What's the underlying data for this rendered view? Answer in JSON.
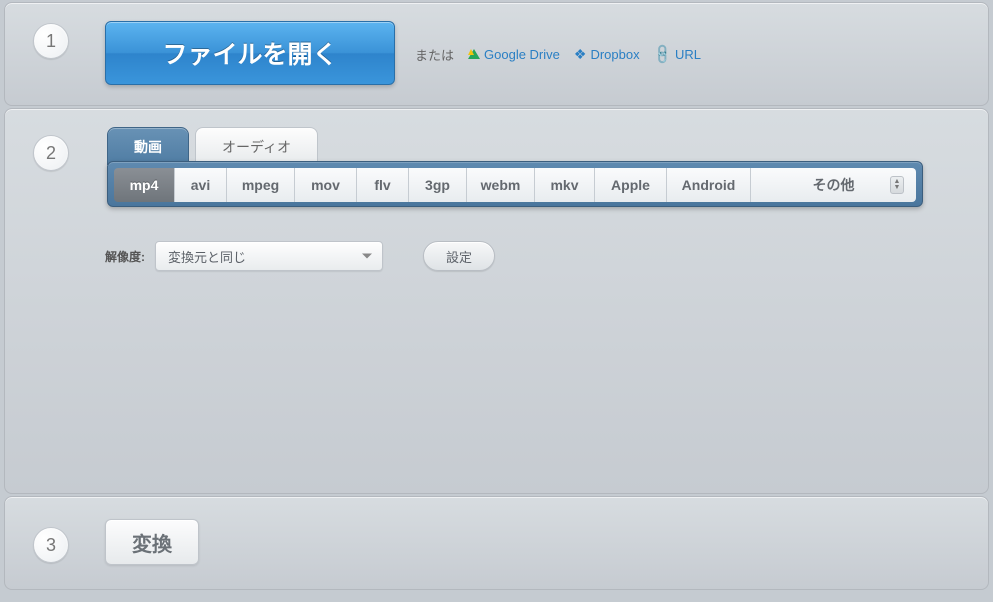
{
  "steps": {
    "one": "1",
    "two": "2",
    "three": "3"
  },
  "open": {
    "button": "ファイルを開く",
    "or": "または",
    "google_drive": "Google Drive",
    "dropbox": "Dropbox",
    "url": "URL"
  },
  "tabs": {
    "video": "動画",
    "audio": "オーディオ"
  },
  "formats": {
    "mp4": "mp4",
    "avi": "avi",
    "mpeg": "mpeg",
    "mov": "mov",
    "flv": "flv",
    "threegp": "3gp",
    "webm": "webm",
    "mkv": "mkv",
    "apple": "Apple",
    "android": "Android",
    "other": "その他"
  },
  "resolution": {
    "label": "解像度:",
    "value": "変換元と同じ"
  },
  "settings": "設定",
  "convert": "変換"
}
